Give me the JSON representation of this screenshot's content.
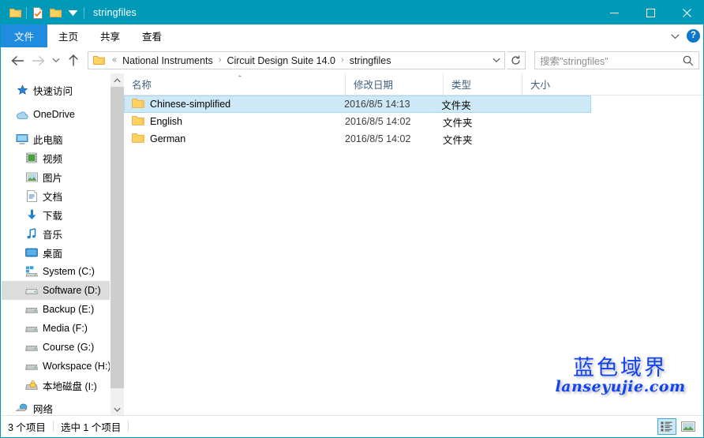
{
  "window": {
    "title": "stringfiles",
    "titlebar_color": "#0099b8",
    "accent_color": "#1f8ce0"
  },
  "quick_access_toolbar": {
    "items": [
      {
        "name": "folder-icon",
        "label": "属性"
      },
      {
        "name": "properties-icon",
        "label": "属性"
      },
      {
        "name": "new-folder-icon",
        "label": "新建文件夹"
      },
      {
        "name": "chevron-down-icon",
        "label": "自定义快速访问工具栏"
      }
    ]
  },
  "window_controls": {
    "minimize": "最小化",
    "maximize": "最大化",
    "close": "关闭"
  },
  "ribbon": {
    "tabs": [
      {
        "label": "文件",
        "active": true
      },
      {
        "label": "主页",
        "active": false
      },
      {
        "label": "共享",
        "active": false
      },
      {
        "label": "查看",
        "active": false
      }
    ],
    "expand_label": "展开功能区",
    "help_label": "?"
  },
  "navigation": {
    "back": "后退",
    "forward": "前进",
    "recent": "最近浏览的位置",
    "up": "上移一级",
    "refresh": "刷新"
  },
  "address_bar": {
    "overflow": "«",
    "crumbs": [
      "National Instruments",
      "Circuit Design Suite 14.0",
      "stringfiles"
    ],
    "separator": "›",
    "dropdown_label": "历史记录"
  },
  "search": {
    "placeholder": "搜索\"stringfiles\"",
    "icon": "search-icon"
  },
  "sidebar": {
    "items": [
      {
        "label": "快速访问",
        "icon": "star-icon",
        "level": 0,
        "selected": false
      },
      {
        "label": "OneDrive",
        "icon": "onedrive-icon",
        "level": 0,
        "selected": false
      },
      {
        "label": "此电脑",
        "icon": "this-pc-icon",
        "level": 0,
        "selected": false
      },
      {
        "label": "视频",
        "icon": "videos-icon",
        "level": 1,
        "selected": false
      },
      {
        "label": "图片",
        "icon": "pictures-icon",
        "level": 1,
        "selected": false
      },
      {
        "label": "文档",
        "icon": "documents-icon",
        "level": 1,
        "selected": false
      },
      {
        "label": "下载",
        "icon": "downloads-icon",
        "level": 1,
        "selected": false
      },
      {
        "label": "音乐",
        "icon": "music-icon",
        "level": 1,
        "selected": false
      },
      {
        "label": "桌面",
        "icon": "desktop-icon",
        "level": 1,
        "selected": false
      },
      {
        "label": "System (C:)",
        "icon": "system-drive-icon",
        "level": 1,
        "selected": false
      },
      {
        "label": "Software (D:)",
        "icon": "drive-icon",
        "level": 1,
        "selected": true
      },
      {
        "label": "Backup (E:)",
        "icon": "drive-icon",
        "level": 1,
        "selected": false
      },
      {
        "label": "Media (F:)",
        "icon": "drive-icon",
        "level": 1,
        "selected": false
      },
      {
        "label": "Course (G:)",
        "icon": "drive-icon",
        "level": 1,
        "selected": false
      },
      {
        "label": "Workspace (H:)",
        "icon": "drive-icon",
        "level": 1,
        "selected": false
      },
      {
        "label": "本地磁盘 (I:)",
        "icon": "locked-drive-icon",
        "level": 1,
        "selected": false
      },
      {
        "label": "网络",
        "icon": "network-icon",
        "level": 0,
        "selected": false
      }
    ],
    "scrollbar": {
      "up_label": "向上滚动",
      "down_label": "向下滚动"
    }
  },
  "file_list": {
    "columns": [
      {
        "label": "名称",
        "sorted": "asc"
      },
      {
        "label": "修改日期",
        "sorted": ""
      },
      {
        "label": "类型",
        "sorted": ""
      },
      {
        "label": "大小",
        "sorted": ""
      }
    ],
    "sort_caret": "⌃",
    "rows": [
      {
        "name": "Chinese-simplified",
        "date": "2016/8/5 14:13",
        "type": "文件夹",
        "size": "",
        "icon": "folder-icon",
        "selected": true
      },
      {
        "name": "English",
        "date": "2016/8/5 14:02",
        "type": "文件夹",
        "size": "",
        "icon": "folder-icon",
        "selected": false
      },
      {
        "name": "German",
        "date": "2016/8/5 14:02",
        "type": "文件夹",
        "size": "",
        "icon": "folder-icon",
        "selected": false
      }
    ]
  },
  "watermark": {
    "chinese": "蓝色域界",
    "latin": "lanseyujie.com",
    "color": "#1144ee"
  },
  "status_bar": {
    "item_count": "3 个项目",
    "selection": "选中 1 个项目",
    "views": [
      {
        "name": "details-view-button",
        "label": "详细信息",
        "active": true
      },
      {
        "name": "large-icons-view-button",
        "label": "大图标",
        "active": false
      }
    ]
  }
}
